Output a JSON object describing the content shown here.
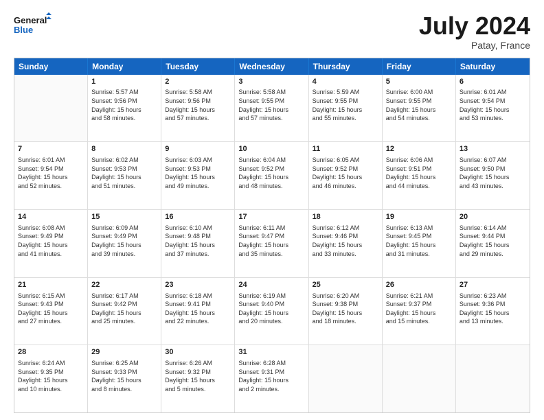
{
  "header": {
    "logo_line1": "General",
    "logo_line2": "Blue",
    "month_year": "July 2024",
    "location": "Patay, France"
  },
  "weekdays": [
    "Sunday",
    "Monday",
    "Tuesday",
    "Wednesday",
    "Thursday",
    "Friday",
    "Saturday"
  ],
  "rows": [
    [
      {
        "day": "",
        "text": ""
      },
      {
        "day": "1",
        "text": "Sunrise: 5:57 AM\nSunset: 9:56 PM\nDaylight: 15 hours\nand 58 minutes."
      },
      {
        "day": "2",
        "text": "Sunrise: 5:58 AM\nSunset: 9:56 PM\nDaylight: 15 hours\nand 57 minutes."
      },
      {
        "day": "3",
        "text": "Sunrise: 5:58 AM\nSunset: 9:55 PM\nDaylight: 15 hours\nand 57 minutes."
      },
      {
        "day": "4",
        "text": "Sunrise: 5:59 AM\nSunset: 9:55 PM\nDaylight: 15 hours\nand 55 minutes."
      },
      {
        "day": "5",
        "text": "Sunrise: 6:00 AM\nSunset: 9:55 PM\nDaylight: 15 hours\nand 54 minutes."
      },
      {
        "day": "6",
        "text": "Sunrise: 6:01 AM\nSunset: 9:54 PM\nDaylight: 15 hours\nand 53 minutes."
      }
    ],
    [
      {
        "day": "7",
        "text": "Sunrise: 6:01 AM\nSunset: 9:54 PM\nDaylight: 15 hours\nand 52 minutes."
      },
      {
        "day": "8",
        "text": "Sunrise: 6:02 AM\nSunset: 9:53 PM\nDaylight: 15 hours\nand 51 minutes."
      },
      {
        "day": "9",
        "text": "Sunrise: 6:03 AM\nSunset: 9:53 PM\nDaylight: 15 hours\nand 49 minutes."
      },
      {
        "day": "10",
        "text": "Sunrise: 6:04 AM\nSunset: 9:52 PM\nDaylight: 15 hours\nand 48 minutes."
      },
      {
        "day": "11",
        "text": "Sunrise: 6:05 AM\nSunset: 9:52 PM\nDaylight: 15 hours\nand 46 minutes."
      },
      {
        "day": "12",
        "text": "Sunrise: 6:06 AM\nSunset: 9:51 PM\nDaylight: 15 hours\nand 44 minutes."
      },
      {
        "day": "13",
        "text": "Sunrise: 6:07 AM\nSunset: 9:50 PM\nDaylight: 15 hours\nand 43 minutes."
      }
    ],
    [
      {
        "day": "14",
        "text": "Sunrise: 6:08 AM\nSunset: 9:49 PM\nDaylight: 15 hours\nand 41 minutes."
      },
      {
        "day": "15",
        "text": "Sunrise: 6:09 AM\nSunset: 9:49 PM\nDaylight: 15 hours\nand 39 minutes."
      },
      {
        "day": "16",
        "text": "Sunrise: 6:10 AM\nSunset: 9:48 PM\nDaylight: 15 hours\nand 37 minutes."
      },
      {
        "day": "17",
        "text": "Sunrise: 6:11 AM\nSunset: 9:47 PM\nDaylight: 15 hours\nand 35 minutes."
      },
      {
        "day": "18",
        "text": "Sunrise: 6:12 AM\nSunset: 9:46 PM\nDaylight: 15 hours\nand 33 minutes."
      },
      {
        "day": "19",
        "text": "Sunrise: 6:13 AM\nSunset: 9:45 PM\nDaylight: 15 hours\nand 31 minutes."
      },
      {
        "day": "20",
        "text": "Sunrise: 6:14 AM\nSunset: 9:44 PM\nDaylight: 15 hours\nand 29 minutes."
      }
    ],
    [
      {
        "day": "21",
        "text": "Sunrise: 6:15 AM\nSunset: 9:43 PM\nDaylight: 15 hours\nand 27 minutes."
      },
      {
        "day": "22",
        "text": "Sunrise: 6:17 AM\nSunset: 9:42 PM\nDaylight: 15 hours\nand 25 minutes."
      },
      {
        "day": "23",
        "text": "Sunrise: 6:18 AM\nSunset: 9:41 PM\nDaylight: 15 hours\nand 22 minutes."
      },
      {
        "day": "24",
        "text": "Sunrise: 6:19 AM\nSunset: 9:40 PM\nDaylight: 15 hours\nand 20 minutes."
      },
      {
        "day": "25",
        "text": "Sunrise: 6:20 AM\nSunset: 9:38 PM\nDaylight: 15 hours\nand 18 minutes."
      },
      {
        "day": "26",
        "text": "Sunrise: 6:21 AM\nSunset: 9:37 PM\nDaylight: 15 hours\nand 15 minutes."
      },
      {
        "day": "27",
        "text": "Sunrise: 6:23 AM\nSunset: 9:36 PM\nDaylight: 15 hours\nand 13 minutes."
      }
    ],
    [
      {
        "day": "28",
        "text": "Sunrise: 6:24 AM\nSunset: 9:35 PM\nDaylight: 15 hours\nand 10 minutes."
      },
      {
        "day": "29",
        "text": "Sunrise: 6:25 AM\nSunset: 9:33 PM\nDaylight: 15 hours\nand 8 minutes."
      },
      {
        "day": "30",
        "text": "Sunrise: 6:26 AM\nSunset: 9:32 PM\nDaylight: 15 hours\nand 5 minutes."
      },
      {
        "day": "31",
        "text": "Sunrise: 6:28 AM\nSunset: 9:31 PM\nDaylight: 15 hours\nand 2 minutes."
      },
      {
        "day": "",
        "text": ""
      },
      {
        "day": "",
        "text": ""
      },
      {
        "day": "",
        "text": ""
      }
    ]
  ]
}
